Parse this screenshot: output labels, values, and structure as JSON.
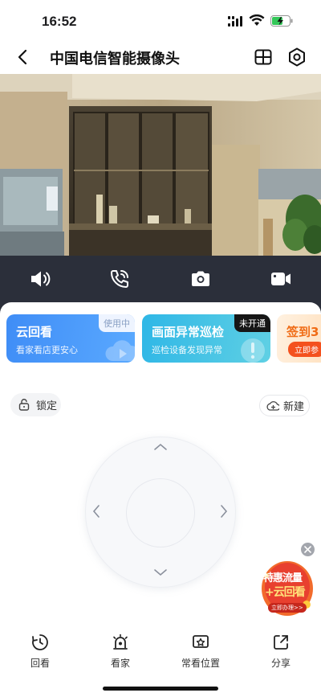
{
  "status_bar": {
    "time": "16:52"
  },
  "nav": {
    "title": "中国电信智能摄像头"
  },
  "cards": [
    {
      "title": "云回看",
      "subtitle": "看家看店更安心",
      "badge": "使用中"
    },
    {
      "title": "画面异常巡检",
      "subtitle": "巡检设备发现异常",
      "badge": "未开通"
    },
    {
      "title": "签到3",
      "subtitle": "立即参"
    }
  ],
  "lock": {
    "label": "锁定"
  },
  "new_preset": {
    "label": "新建"
  },
  "promo": {
    "line1": "特惠流量",
    "line2": "+云回看",
    "cta": "立即办理>>"
  },
  "tabs": [
    {
      "label": "回看",
      "icon": "playback-clock-icon"
    },
    {
      "label": "看家",
      "icon": "alarm-siren-icon"
    },
    {
      "label": "常看位置",
      "icon": "favorite-location-icon"
    },
    {
      "label": "分享",
      "icon": "share-icon"
    }
  ],
  "colors": {
    "accent": "#1677ff",
    "controls_bg": "#2b2f3a",
    "card1": "#3d8cf5",
    "card2": "#37b8e0",
    "badge_dark": "#1a1a1a"
  }
}
